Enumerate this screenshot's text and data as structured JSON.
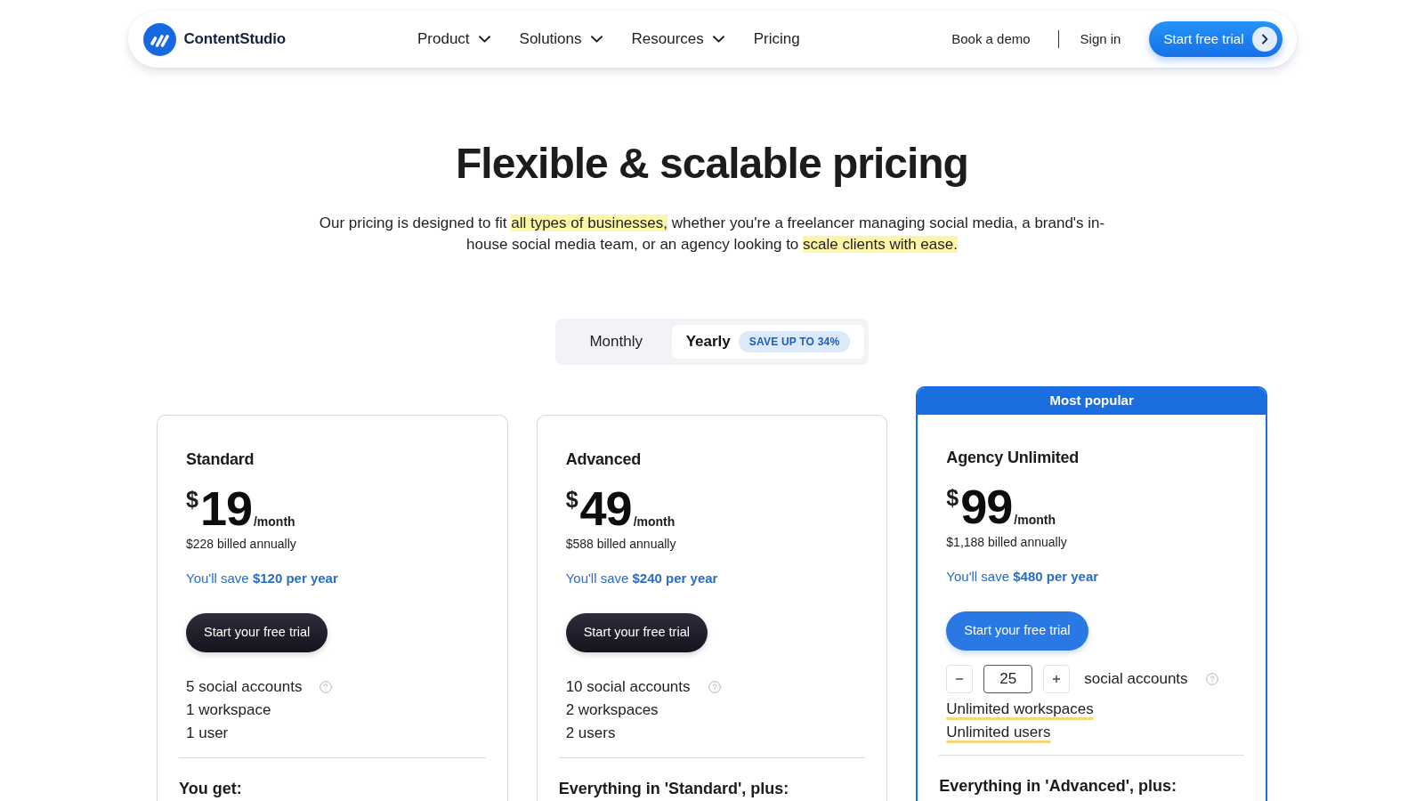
{
  "navbar": {
    "brand": "ContentStudio",
    "menu": [
      {
        "label": "Product",
        "dropdown": true
      },
      {
        "label": "Solutions",
        "dropdown": true
      },
      {
        "label": "Resources",
        "dropdown": true
      },
      {
        "label": "Pricing",
        "dropdown": false
      }
    ],
    "links": [
      "Book a demo",
      "Sign in"
    ],
    "cta": "Start free trial"
  },
  "hero": {
    "title": "Flexible & scalable pricing",
    "subtitle": [
      {
        "text": "Our pricing is designed to fit ",
        "highlight": false
      },
      {
        "text": "all types of businesses,",
        "highlight": true
      },
      {
        "text": " whether you're a freelancer managing social media, a brand's in-house social media team, or an agency looking to ",
        "highlight": false
      },
      {
        "text": "scale clients with ease.",
        "highlight": true
      }
    ]
  },
  "billing_toggle": [
    {
      "label": "Monthly",
      "selected": false
    },
    {
      "label": "Yearly",
      "selected": true,
      "badge": "SAVE UP TO 34%"
    }
  ],
  "plans": [
    {
      "name": "Standard",
      "featured": false,
      "currency": "$",
      "price": "19",
      "period": "/month",
      "billed": "$228 billed annually",
      "savings": "You'll save **$120 per year**",
      "button": "Start your free trial",
      "features": [
        {
          "kind": "text",
          "label": "5 social accounts",
          "info": true,
          "underline": false
        },
        {
          "kind": "text",
          "label": "1 workspace",
          "info": false,
          "underline": false
        },
        {
          "kind": "text",
          "label": "1 user",
          "info": false,
          "underline": false
        }
      ],
      "includes_heading": "You get:"
    },
    {
      "name": "Advanced",
      "featured": false,
      "currency": "$",
      "price": "49",
      "period": "/month",
      "billed": "$588 billed annually",
      "savings": "You'll save **$240 per year**",
      "button": "Start your free trial",
      "features": [
        {
          "kind": "text",
          "label": "10 social accounts",
          "info": true,
          "underline": false
        },
        {
          "kind": "text",
          "label": "2 workspaces",
          "info": false,
          "underline": false
        },
        {
          "kind": "text",
          "label": "2 users",
          "info": false,
          "underline": false
        }
      ],
      "includes_heading": "Everything in 'Standard', plus:"
    },
    {
      "name": "Agency Unlimited",
      "featured": true,
      "ribbon": "Most popular",
      "currency": "$",
      "price": "99",
      "period": "/month",
      "billed": "$1,188 billed annually",
      "savings": "You'll save **$480 per year**",
      "button": "Start your free trial",
      "features": [
        {
          "kind": "stepper",
          "count": "25",
          "label": "social accounts",
          "info": true,
          "underline": false
        },
        {
          "kind": "text",
          "label": "Unlimited workspaces",
          "info": false,
          "underline": true
        },
        {
          "kind": "text",
          "label": "Unlimited users",
          "info": false,
          "underline": true
        }
      ],
      "includes_heading": "Everything in 'Advanced', plus:"
    }
  ]
}
